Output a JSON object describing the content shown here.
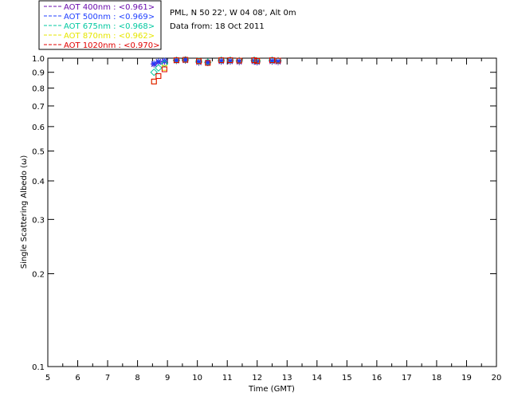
{
  "chart_data": {
    "type": "scatter",
    "info": {
      "site": "PML, N 50 22', W 04 08', Alt 0m",
      "date": "Data from: 18 Oct 2011"
    },
    "xlabel": "Time (GMT)",
    "ylabel": "Single Scattering Albedo (ω)",
    "xlim": [
      5,
      20
    ],
    "ylim": [
      0.1,
      1.0
    ],
    "yscale": "log",
    "xticks": [
      "5",
      "6",
      "7",
      "8",
      "9",
      "10",
      "11",
      "12",
      "13",
      "14",
      "15",
      "16",
      "17",
      "18",
      "19",
      "20"
    ],
    "yticks": [
      {
        "value": 1.0,
        "label": "1.0"
      },
      {
        "value": 0.9,
        "label": "0.9"
      },
      {
        "value": 0.8,
        "label": "0.8"
      },
      {
        "value": 0.7,
        "label": "0.7"
      },
      {
        "value": 0.6,
        "label": "0.6"
      },
      {
        "value": 0.5,
        "label": "0.5"
      },
      {
        "value": 0.4,
        "label": "0.4"
      },
      {
        "value": 0.3,
        "label": "0.3"
      },
      {
        "value": 0.2,
        "label": "0.2"
      },
      {
        "value": 0.1,
        "label": "0.1"
      }
    ],
    "legend_position": "top-left",
    "series": [
      {
        "name": "AOT  400nm : <0.961>",
        "color": "#6a0dad",
        "marker": "star",
        "x": [
          8.55,
          8.7,
          8.9,
          9.3,
          9.6,
          10.05,
          10.35,
          10.8,
          11.1,
          11.4,
          11.9,
          12.0,
          12.5,
          12.7
        ],
        "y": [
          0.955,
          0.97,
          0.975,
          0.98,
          0.982,
          0.968,
          0.965,
          0.975,
          0.975,
          0.972,
          0.975,
          0.97,
          0.975,
          0.972
        ]
      },
      {
        "name": "AOT  500nm : <0.969>",
        "color": "#1f3fff",
        "marker": "star",
        "x": [
          8.55,
          8.7,
          8.9,
          9.3,
          9.6,
          10.05,
          10.35,
          10.8,
          11.1,
          11.4,
          11.9,
          12.0,
          12.5,
          12.7
        ],
        "y": [
          0.96,
          0.975,
          0.98,
          0.985,
          0.988,
          0.975,
          0.97,
          0.98,
          0.98,
          0.978,
          0.98,
          0.975,
          0.98,
          0.977
        ]
      },
      {
        "name": "AOT  675nm : <0.968>",
        "color": "#00c8a0",
        "marker": "diamond",
        "x": [
          8.55,
          8.7,
          8.9,
          9.3,
          9.6,
          10.05,
          10.35,
          10.8,
          11.1,
          11.4,
          11.9,
          12.0,
          12.5,
          12.7
        ],
        "y": [
          0.9,
          0.93,
          0.96,
          0.985,
          0.988,
          0.978,
          0.97,
          0.985,
          0.985,
          0.982,
          0.985,
          0.98,
          0.985,
          0.982
        ]
      },
      {
        "name": "AOT  870nm : <0.962>",
        "color": "#e6e600",
        "marker": "square",
        "x": [
          8.55,
          8.7,
          8.9,
          9.3,
          9.6,
          10.05,
          10.35,
          10.8,
          11.1,
          11.4,
          11.9,
          12.0,
          12.5,
          12.7
        ],
        "y": [
          0.84,
          0.875,
          0.93,
          0.985,
          0.988,
          0.978,
          0.965,
          0.985,
          0.985,
          0.982,
          0.985,
          0.98,
          0.985,
          0.982
        ]
      },
      {
        "name": "AOT 1020nm : <0.970>",
        "color": "#e00000",
        "marker": "square",
        "x": [
          8.55,
          8.7,
          8.9,
          9.3,
          9.6,
          10.05,
          10.35,
          10.8,
          11.1,
          11.4,
          11.9,
          12.0,
          12.5,
          12.7
        ],
        "y": [
          0.84,
          0.875,
          0.92,
          0.985,
          0.988,
          0.978,
          0.965,
          0.985,
          0.985,
          0.982,
          0.985,
          0.98,
          0.985,
          0.982
        ]
      }
    ]
  }
}
